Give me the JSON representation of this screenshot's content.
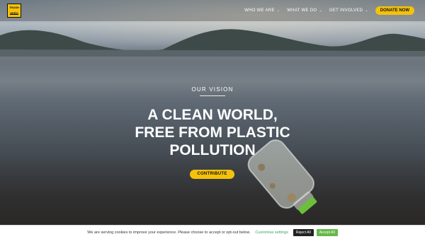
{
  "brand": {
    "logo_line1": "TRASH",
    "logo_line2": "HERO"
  },
  "nav": {
    "items": [
      {
        "label": "WHO WE ARE"
      },
      {
        "label": "WHAT WE DO"
      },
      {
        "label": "GET INVOLVED"
      }
    ],
    "donate_label": "DONATE NOW"
  },
  "hero": {
    "eyebrow": "OUR VISION",
    "headline_lines": [
      "A CLEAN WORLD,",
      "FREE FROM PLASTIC",
      "POLLUTION"
    ],
    "cta_label": "CONTRIBUTE"
  },
  "cookie_bar": {
    "message": "We are serving cookies to improve your experience. Please choose to accept or opt-out below.",
    "settings_label": "Customise settings",
    "reject_label": "Reject All",
    "accept_label": "Accept All"
  },
  "colors": {
    "accent": "#f5c20b",
    "accept_green": "#64b94a",
    "link_green": "#3aa36b"
  }
}
